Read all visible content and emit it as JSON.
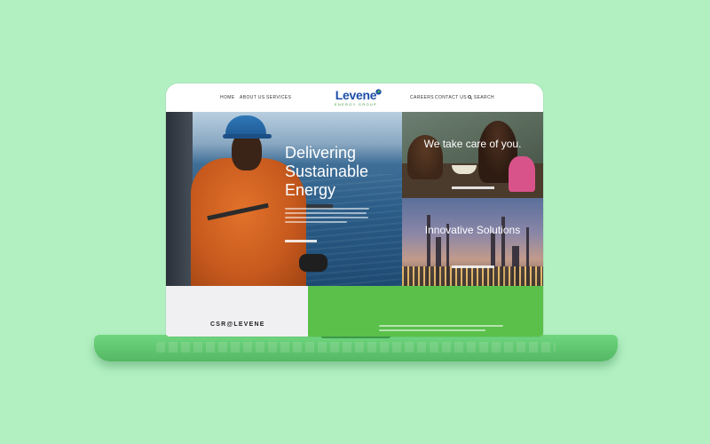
{
  "colors": {
    "background": "#b2f0c2",
    "brand_blue": "#1e4fa8",
    "brand_green": "#5ac04a"
  },
  "nav": {
    "left": [
      "HOME",
      "ABOUT US",
      "SERVICES"
    ],
    "right": [
      "CAREERS",
      "CONTACT US",
      "SEARCH"
    ]
  },
  "logo": {
    "name": "Levene",
    "tagline": "ENERGY GROUP"
  },
  "hero": {
    "title": "Delivering Sustainable Energy"
  },
  "tiles": [
    {
      "title": "We take care of you."
    },
    {
      "title": "Innovative Solutions"
    }
  ],
  "csr": {
    "label": "CSR@LEVENE"
  }
}
